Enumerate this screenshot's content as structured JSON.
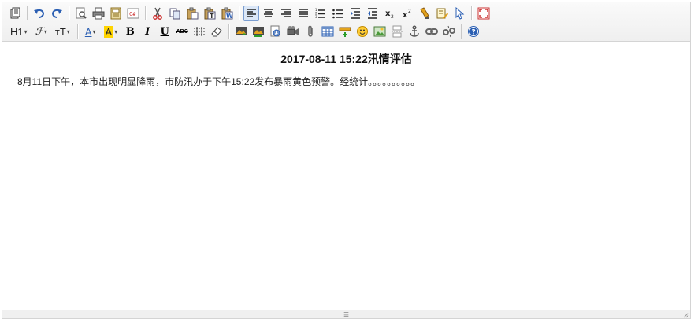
{
  "toolbar": {
    "h1_label": "H1",
    "font_label": "ℱ",
    "size_label": "ᴛT",
    "font_color_label": "A",
    "bg_color_label": "A",
    "bold_label": "B",
    "italic_label": "I",
    "underline_label": "U",
    "strike_label": "ABC",
    "caret": "▾",
    "highlight_color": "#ffd400",
    "accent_color": "#2b5fb3"
  },
  "document": {
    "title": "2017-08-11 15:22汛情评估",
    "body": "8月11日下午，本市出现明显降雨，市防汛办于下午15:22发布暴雨黄色预警。经统计。。。。。。。。。。"
  },
  "statusbar": {
    "resize_glyph": "≣"
  }
}
